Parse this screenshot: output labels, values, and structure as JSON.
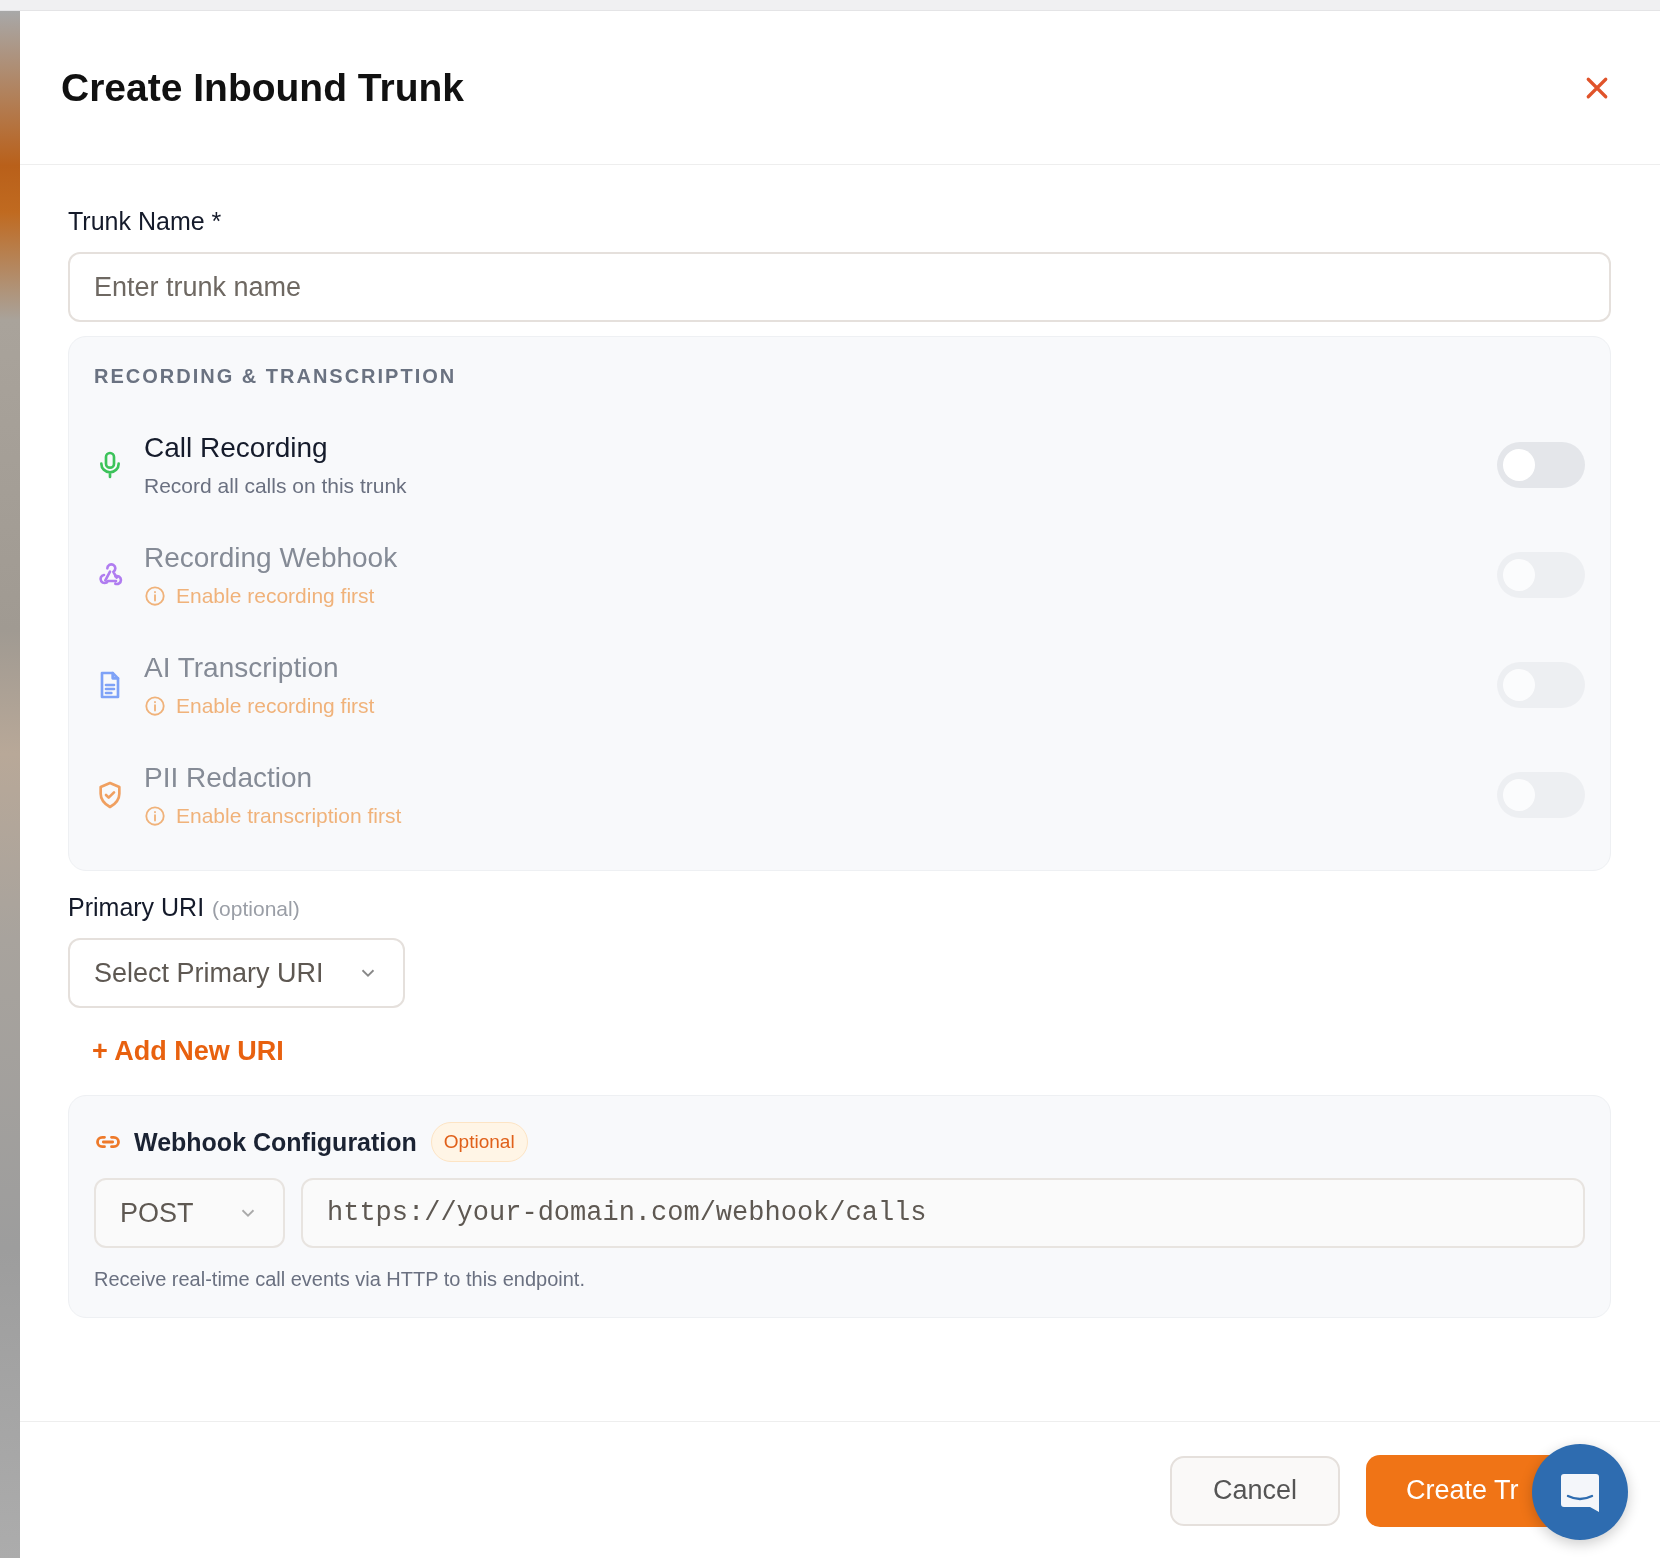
{
  "dialog": {
    "title": "Create Inbound Trunk"
  },
  "trunk_name": {
    "label": "Trunk Name *",
    "placeholder": "Enter trunk name"
  },
  "recording_section": {
    "heading": "RECORDING & TRANSCRIPTION",
    "items": [
      {
        "kind": "microphone",
        "title": "Call Recording",
        "description": "Record all calls on this trunk",
        "disabled": false,
        "on": false
      },
      {
        "kind": "webhook",
        "title": "Recording Webhook",
        "description": "Enable recording first",
        "disabled": true,
        "on": false
      },
      {
        "kind": "document",
        "title": "AI Transcription",
        "description": "Enable recording first",
        "disabled": true,
        "on": false
      },
      {
        "kind": "shield",
        "title": "PII Redaction",
        "description": "Enable transcription first",
        "disabled": true,
        "on": false
      }
    ]
  },
  "primary_uri": {
    "label": "Primary URI",
    "hint": "(optional)",
    "placeholder": "Select Primary URI",
    "add_link": "+ Add New URI"
  },
  "webhook": {
    "title": "Webhook Configuration",
    "badge": "Optional",
    "method": "POST",
    "url_placeholder": "https://your-domain.com/webhook/calls",
    "help": "Receive real-time call events via HTTP to this endpoint."
  },
  "buttons": {
    "cancel": "Cancel",
    "submit": "Create Tr"
  }
}
